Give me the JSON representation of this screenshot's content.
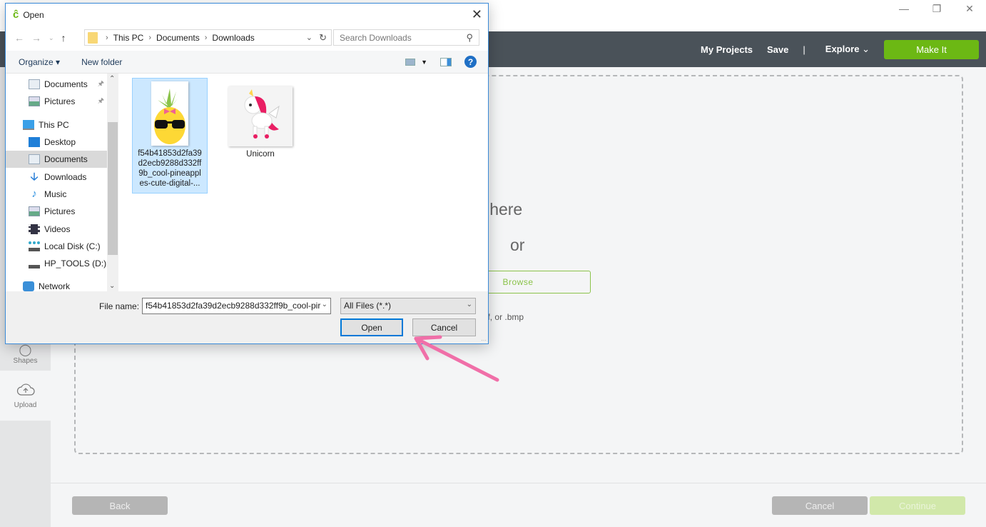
{
  "window": {
    "controls": [
      "minimize",
      "restore",
      "close"
    ]
  },
  "appbar": {
    "nav": {
      "my_projects": "My Projects",
      "save": "Save",
      "separator": "|",
      "explore": "Explore",
      "make_it": "Make It"
    },
    "accent": "#6cb814"
  },
  "left_rail": {
    "items": [
      {
        "label": "Shapes",
        "icon": "shapes-icon"
      },
      {
        "label": "Upload",
        "icon": "cloud-upload-icon"
      }
    ]
  },
  "upload": {
    "drop_text": "Drag & drop file here",
    "or_text": "or",
    "browse_label": "Browse",
    "formats_text": ".jpg, .png, .gif, .svg, .dxf, or .bmp"
  },
  "footer": {
    "back": "Back",
    "cancel": "Cancel",
    "continue": "Continue"
  },
  "dialog": {
    "title": "Open",
    "breadcrumb": [
      "This PC",
      "Documents",
      "Downloads"
    ],
    "search_placeholder": "Search Downloads",
    "toolbar": {
      "organize": "Organize ▾",
      "new_folder": "New folder"
    },
    "nav_items": [
      {
        "label": "Documents",
        "icon": "document-icon",
        "pinned": true
      },
      {
        "label": "Pictures",
        "icon": "pictures-icon",
        "pinned": true
      },
      {
        "label": "This PC",
        "icon": "computer-icon"
      },
      {
        "label": "Desktop",
        "icon": "desktop-icon"
      },
      {
        "label": "Documents",
        "icon": "document-icon",
        "selected": true
      },
      {
        "label": "Downloads",
        "icon": "download-icon"
      },
      {
        "label": "Music",
        "icon": "music-icon"
      },
      {
        "label": "Pictures",
        "icon": "pictures-icon"
      },
      {
        "label": "Videos",
        "icon": "videos-icon"
      },
      {
        "label": "Local Disk (C:)",
        "icon": "drive-icon"
      },
      {
        "label": "HP_TOOLS (D:)",
        "icon": "drive-icon"
      },
      {
        "label": "Network",
        "icon": "network-icon"
      }
    ],
    "files": [
      {
        "name": "f54b41853d2fa39 d2ecb9288d332ff 9b_cool-pineappl es-cute-digital-...",
        "selected": true,
        "thumb": "pineapple"
      },
      {
        "name": "Unicorn",
        "selected": false,
        "thumb": "unicorn"
      }
    ],
    "file_name_label": "File name:",
    "file_name_value": "f54b41853d2fa39d2ecb9288d332ff9b_cool-pir",
    "file_type": "All Files (*.*)",
    "open": "Open",
    "cancel": "Cancel"
  }
}
